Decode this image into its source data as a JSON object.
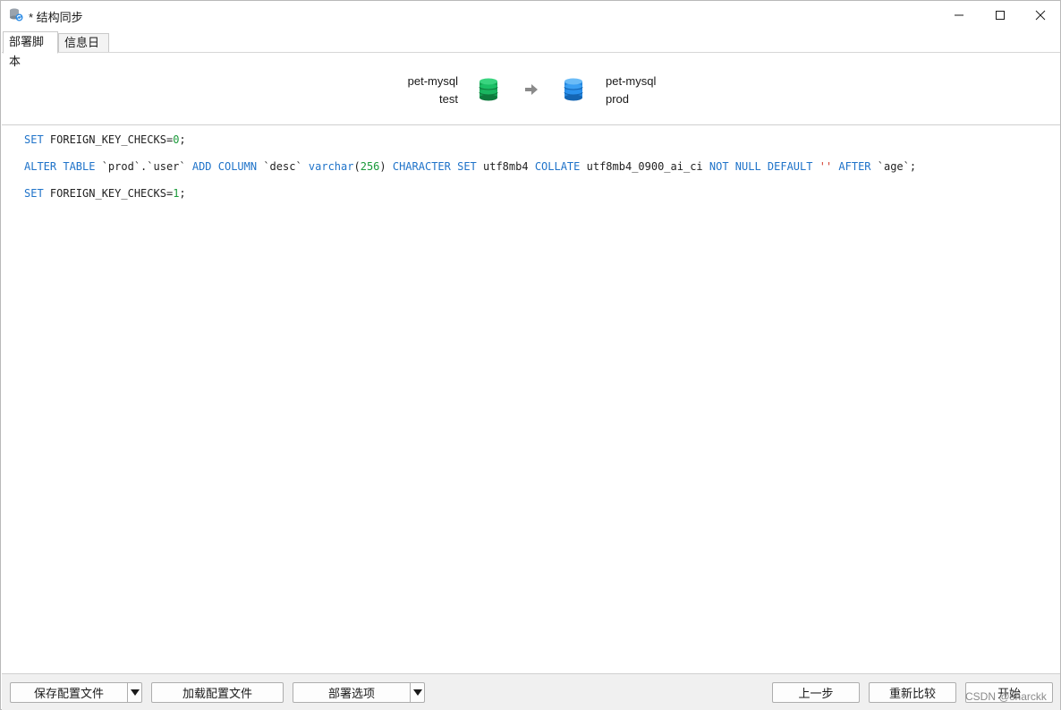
{
  "window": {
    "title": "* 结构同步",
    "icon": "db-sync-icon",
    "controls": {
      "minimize": "minimize-icon",
      "maximize": "maximize-icon",
      "close": "close-icon"
    }
  },
  "tabs": [
    {
      "label": "部署脚本",
      "active": true
    },
    {
      "label": "信息日志",
      "active": false
    }
  ],
  "header": {
    "source": {
      "connection": "pet-mysql",
      "database": "test",
      "color": "#1aa65a"
    },
    "target": {
      "connection": "pet-mysql",
      "database": "prod",
      "color": "#2e8de6"
    },
    "arrow_icon": "arrow-right-icon"
  },
  "sql": {
    "line1": {
      "kw1": "SET",
      "text": " FOREIGN_KEY_CHECKS=",
      "num": "0",
      "end": ";"
    },
    "line2": {
      "kw_alter": "ALTER TABLE",
      "t1": " `prod`.`user` ",
      "kw_add": "ADD COLUMN",
      "t2": " `desc` ",
      "kw_type": "varchar",
      "p_open": "(",
      "len": "256",
      "p_close": ") ",
      "kw_charset": "CHARACTER SET",
      "t3": " utf8mb4 ",
      "kw_collate": "COLLATE",
      "t4": " utf8mb4_0900_ai_ci ",
      "kw_notnull": "NOT NULL DEFAULT",
      "sp": " ",
      "str": "''",
      "sp2": " ",
      "kw_after": "AFTER",
      "t5": " `age`;"
    },
    "line3": {
      "kw1": "SET",
      "text": " FOREIGN_KEY_CHECKS=",
      "num": "1",
      "end": ";"
    }
  },
  "footer": {
    "save_config": "保存配置文件",
    "load_config": "加载配置文件",
    "deploy_options": "部署选项",
    "prev_step": "上一步",
    "recompare": "重新比较",
    "start": "开始"
  },
  "watermark": "CSDN @snarckk"
}
